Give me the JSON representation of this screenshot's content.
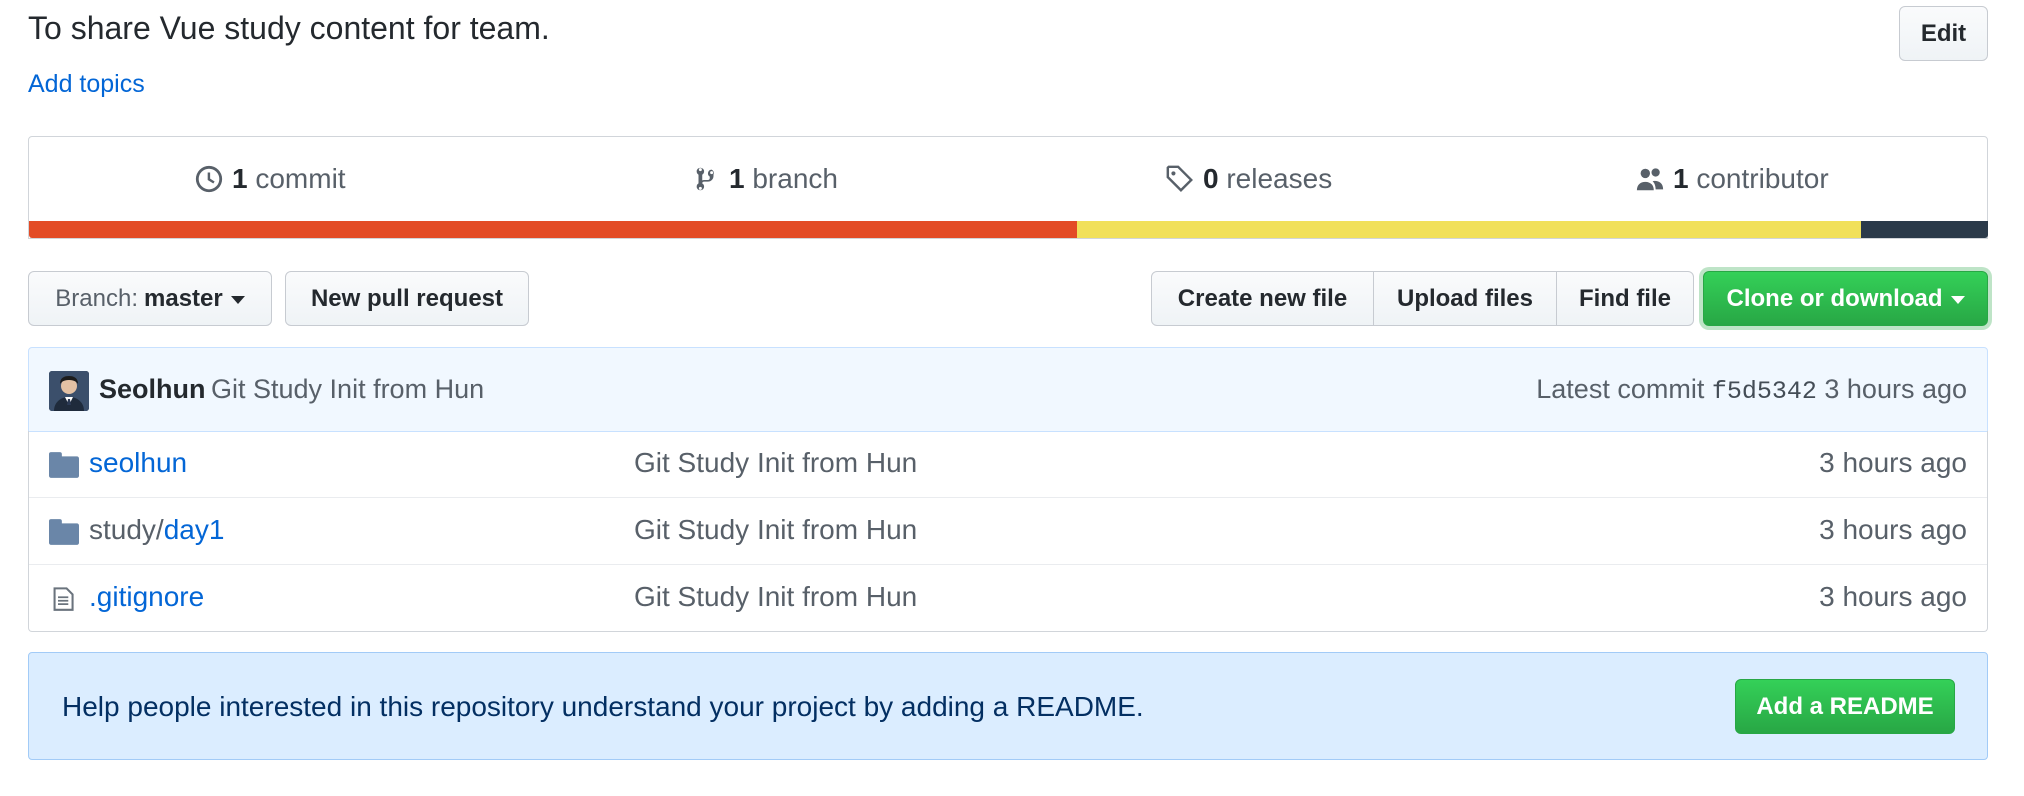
{
  "repo": {
    "description": "To share Vue study content for team.",
    "add_topics": "Add topics",
    "edit_label": "Edit"
  },
  "summary": {
    "commits": {
      "count": "1",
      "label": "commit",
      "icon": "history-icon"
    },
    "branches": {
      "count": "1",
      "label": "branch",
      "icon": "git-branch-icon"
    },
    "releases": {
      "count": "0",
      "label": "releases",
      "icon": "tag-icon"
    },
    "contributors": {
      "count": "1",
      "label": "contributor",
      "icon": "people-icon"
    }
  },
  "language_bar": [
    {
      "color": "#e34c26",
      "fraction": 0.535
    },
    {
      "color": "#f1e05a",
      "fraction": 0.4
    },
    {
      "color": "#2b3a4a",
      "fraction": 0.065
    }
  ],
  "toolbar": {
    "branch_prefix": "Branch:",
    "branch_name": "master",
    "new_pull_request": "New pull request",
    "create_new_file": "Create new file",
    "upload_files": "Upload files",
    "find_file": "Find file",
    "clone_or_download": "Clone or download"
  },
  "latest_commit": {
    "author": "Seolhun",
    "message": "Git Study Init from Hun",
    "label": "Latest commit",
    "sha": "f5d5342",
    "age": "3 hours ago"
  },
  "files": [
    {
      "type": "folder",
      "icon": "folder-icon",
      "dir_prefix": "",
      "name": "seolhun",
      "message": "Git Study Init from Hun",
      "age": "3 hours ago"
    },
    {
      "type": "folder",
      "icon": "folder-icon",
      "dir_prefix": "study/",
      "name": "day1",
      "message": "Git Study Init from Hun",
      "age": "3 hours ago"
    },
    {
      "type": "file",
      "icon": "file-icon",
      "dir_prefix": "",
      "name": ".gitignore",
      "message": "Git Study Init from Hun",
      "age": "3 hours ago"
    }
  ],
  "readme_banner": {
    "text": "Help people interested in this repository understand your project by adding a README.",
    "button": "Add a README"
  },
  "colors": {
    "link": "#0366d6",
    "primary_button": "#28a745",
    "muted_text": "#586069"
  }
}
